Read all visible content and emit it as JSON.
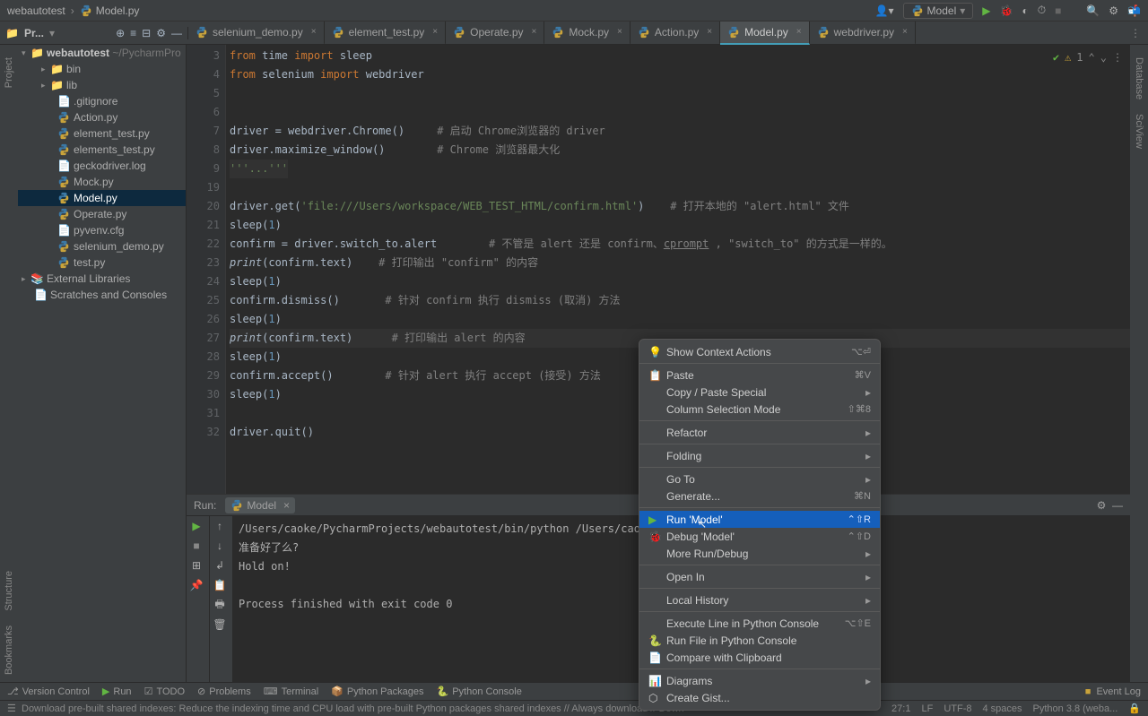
{
  "breadcrumb": {
    "project": "webautotest",
    "file": "Model.py"
  },
  "toolbar": {
    "run_config": "Model"
  },
  "project_panel": {
    "label": "Pr..."
  },
  "tree": {
    "root": {
      "name": "webautotest",
      "path": "~/PycharmPro"
    },
    "items": [
      {
        "name": "bin",
        "type": "folder"
      },
      {
        "name": "lib",
        "type": "folder"
      },
      {
        "name": ".gitignore",
        "type": "file"
      },
      {
        "name": "Action.py",
        "type": "py"
      },
      {
        "name": "element_test.py",
        "type": "py"
      },
      {
        "name": "elements_test.py",
        "type": "py"
      },
      {
        "name": "geckodriver.log",
        "type": "file"
      },
      {
        "name": "Mock.py",
        "type": "py"
      },
      {
        "name": "Model.py",
        "type": "py",
        "selected": true
      },
      {
        "name": "Operate.py",
        "type": "py"
      },
      {
        "name": "pyvenv.cfg",
        "type": "file"
      },
      {
        "name": "selenium_demo.py",
        "type": "py"
      },
      {
        "name": "test.py",
        "type": "py"
      }
    ],
    "external": "External Libraries",
    "scratches": "Scratches and Consoles"
  },
  "tabs": [
    {
      "name": "selenium_demo.py"
    },
    {
      "name": "element_test.py"
    },
    {
      "name": "Operate.py"
    },
    {
      "name": "Mock.py"
    },
    {
      "name": "Action.py"
    },
    {
      "name": "Model.py",
      "active": true
    },
    {
      "name": "webdriver.py"
    }
  ],
  "gutter_start": 3,
  "gutter_end": 32,
  "inspection": "1",
  "code": {
    "l3": {
      "a": "from ",
      "b": "time ",
      "c": "import ",
      "d": "sleep"
    },
    "l4": {
      "a": "from ",
      "b": "selenium ",
      "c": "import ",
      "d": "webdriver"
    },
    "l7": {
      "a": "driver = webdriver.Chrome()     ",
      "b": "# 启动 Chrome浏览器的 driver"
    },
    "l8": {
      "a": "driver.maximize_window()        ",
      "b": "# Chrome 浏览器最大化"
    },
    "l9": {
      "a": "'''...'''"
    },
    "l20": {
      "a": "driver.get(",
      "b": "'file:///Users/workspace/WEB_TEST_HTML/confirm.html'",
      "c": ")    ",
      "d": "# 打开本地的 \"alert.html\" 文件"
    },
    "l21": {
      "a": "sleep(",
      "b": "1",
      "c": ")"
    },
    "l22": {
      "a": "confirm = driver.switch_to.alert        ",
      "b": "# 不管是 alert 还是 confirm、",
      "c": "cprompt",
      "d": " , \"switch_to\" 的方式是一样的。"
    },
    "l23": {
      "a": "print",
      "b": "(confirm.text)    ",
      "c": "# 打印输出 \"confirm\" 的内容"
    },
    "l24": {
      "a": "sleep(",
      "b": "1",
      "c": ")"
    },
    "l25": {
      "a": "confirm.dismiss()       ",
      "b": "# 针对 confirm 执行 dismiss (取消) 方法"
    },
    "l26": {
      "a": "sleep(",
      "b": "1",
      "c": ")"
    },
    "l27": {
      "a": "print",
      "b": "(confirm.text)      ",
      "c": "# 打印输出 alert 的内容"
    },
    "l28": {
      "a": "sleep(",
      "b": "1",
      "c": ")"
    },
    "l29": {
      "a": "confirm.accept()        ",
      "b": "# 针对 alert 执行 accept (接受) 方法"
    },
    "l30": {
      "a": "sleep(",
      "b": "1",
      "c": ")"
    },
    "l32": {
      "a": "driver.quit()"
    }
  },
  "run": {
    "label": "Run:",
    "tab": "Model",
    "output": [
      "/Users/caoke/PycharmProjects/webautotest/bin/python /Users/caoke/PycharmProjec",
      "准备好了么?",
      "Hold on!",
      "",
      "Process finished with exit code 0"
    ]
  },
  "context_menu": [
    {
      "icon": "💡",
      "label": "Show Context Actions",
      "sc": "⌥⏎"
    },
    {
      "sep": true
    },
    {
      "icon": "📋",
      "label": "Paste",
      "sc": "⌘V"
    },
    {
      "label": "Copy / Paste Special",
      "arrow": true
    },
    {
      "label": "Column Selection Mode",
      "sc": "⇧⌘8"
    },
    {
      "sep": true
    },
    {
      "label": "Refactor",
      "arrow": true
    },
    {
      "sep": true
    },
    {
      "label": "Folding",
      "arrow": true
    },
    {
      "sep": true
    },
    {
      "label": "Go To",
      "arrow": true
    },
    {
      "label": "Generate...",
      "sc": "⌘N"
    },
    {
      "sep": true
    },
    {
      "icon": "▶",
      "icon_color": "#62b543",
      "label": "Run 'Model'",
      "sc": "⌃⇧R",
      "selected": true
    },
    {
      "icon": "🐞",
      "label": "Debug 'Model'",
      "sc": "⌃⇧D"
    },
    {
      "label": "More Run/Debug",
      "arrow": true
    },
    {
      "sep": true
    },
    {
      "label": "Open In",
      "arrow": true
    },
    {
      "sep": true
    },
    {
      "label": "Local History",
      "arrow": true
    },
    {
      "sep": true
    },
    {
      "label": "Execute Line in Python Console",
      "sc": "⌥⇧E"
    },
    {
      "icon": "🐍",
      "label": "Run File in Python Console"
    },
    {
      "icon": "📄",
      "label": "Compare with Clipboard"
    },
    {
      "sep": true
    },
    {
      "icon": "📊",
      "label": "Diagrams",
      "arrow": true
    },
    {
      "icon": "⬡",
      "label": "Create Gist..."
    }
  ],
  "bottom_tabs": {
    "vc": "Version Control",
    "run": "Run",
    "todo": "TODO",
    "problems": "Problems",
    "terminal": "Terminal",
    "packages": "Python Packages",
    "console": "Python Console",
    "event_log": "Event Log"
  },
  "status": {
    "msg": "Download pre-built shared indexes: Reduce the indexing time and CPU load with pre-built Python packages shared indexes // Always download // Down",
    "cursor": "27:1",
    "line_sep": "LF",
    "encoding": "UTF-8",
    "indent": "4 spaces",
    "python": "Python 3.8 (weba..."
  },
  "side": {
    "project": "Project",
    "structure": "Structure",
    "bookmarks": "Bookmarks",
    "database": "Database",
    "sciview": "SciView"
  }
}
